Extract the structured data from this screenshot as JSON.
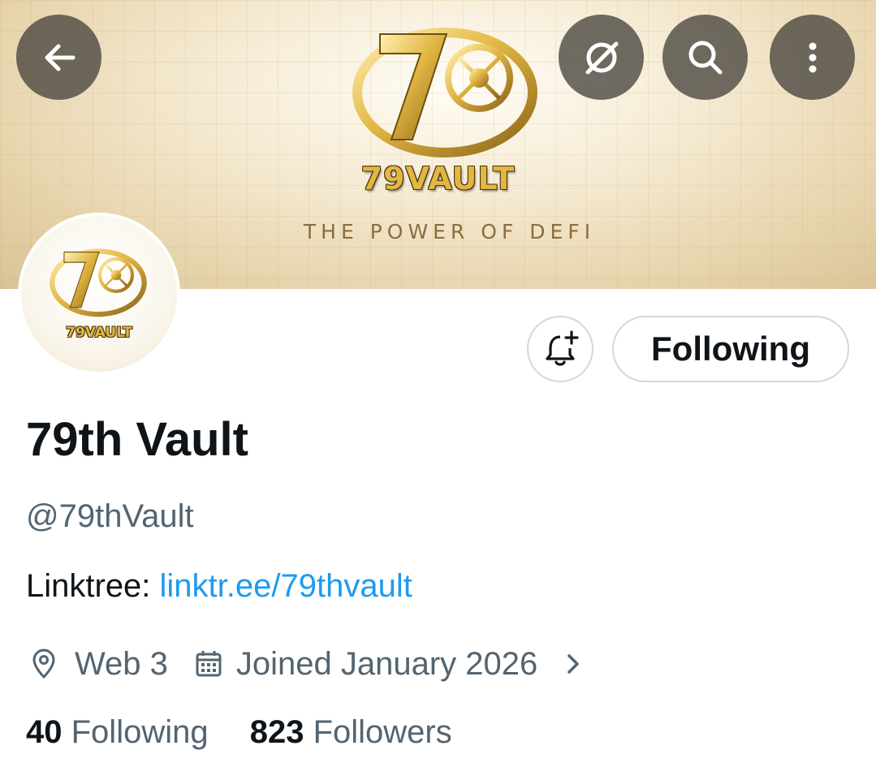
{
  "banner": {
    "logo_numerals": "79",
    "wordmark": "79VAULT",
    "tagline": "THE POWER OF DEFI",
    "colors": {
      "gold": "#e2b642",
      "gold_dark": "#8a6418",
      "background": "#f3e7cc"
    }
  },
  "top_bar": {
    "back_icon": "arrow-left-icon",
    "grok_icon": "grok-icon",
    "search_icon": "search-icon",
    "more_icon": "more-vertical-icon"
  },
  "avatar": {
    "logo_numerals": "79",
    "wordmark": "79VAULT"
  },
  "actions": {
    "notify_icon": "bell-plus-icon",
    "follow_label": "Following"
  },
  "profile": {
    "name": "79th Vault",
    "handle": "@79thVault",
    "bio_prefix": "Linktree: ",
    "bio_link": "linktr.ee/79thvault",
    "location_icon": "location-pin-icon",
    "location": "Web 3",
    "joined_icon": "calendar-icon",
    "joined": "Joined January 2026",
    "chevron_icon": "chevron-right-icon"
  },
  "stats": {
    "following_count": "40",
    "following_label": "Following",
    "followers_count": "823",
    "followers_label": "Followers"
  },
  "colors": {
    "text_primary": "#0f1419",
    "text_secondary": "#536471",
    "link": "#1d9bf0",
    "border": "#cfd9de"
  }
}
